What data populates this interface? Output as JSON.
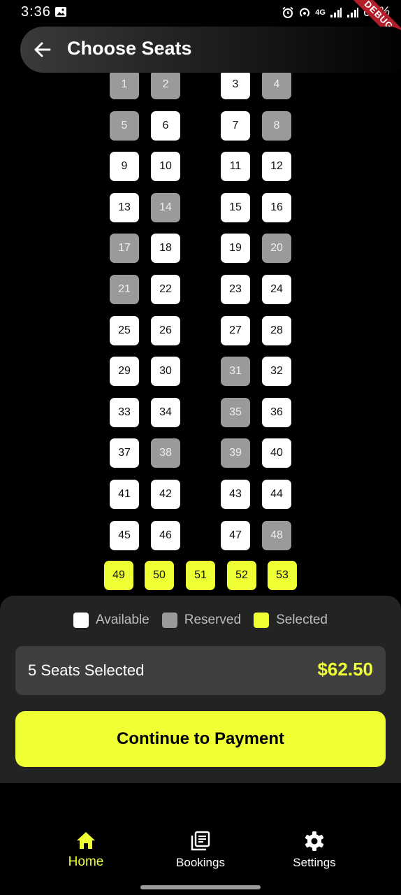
{
  "status_bar": {
    "time": "3:36",
    "battery": "60%",
    "network": "4G",
    "debug_label": "DEBUG"
  },
  "header": {
    "title": "Choose Seats",
    "back_icon": "arrow-left-icon"
  },
  "seats": [
    {
      "n": "1",
      "s": "reserved"
    },
    {
      "n": "2",
      "s": "reserved"
    },
    {
      "n": "3",
      "s": "available"
    },
    {
      "n": "4",
      "s": "reserved"
    },
    {
      "n": "5",
      "s": "reserved"
    },
    {
      "n": "6",
      "s": "available"
    },
    {
      "n": "7",
      "s": "available"
    },
    {
      "n": "8",
      "s": "reserved"
    },
    {
      "n": "9",
      "s": "available"
    },
    {
      "n": "10",
      "s": "available"
    },
    {
      "n": "11",
      "s": "available"
    },
    {
      "n": "12",
      "s": "available"
    },
    {
      "n": "13",
      "s": "available"
    },
    {
      "n": "14",
      "s": "reserved"
    },
    {
      "n": "15",
      "s": "available"
    },
    {
      "n": "16",
      "s": "available"
    },
    {
      "n": "17",
      "s": "reserved"
    },
    {
      "n": "18",
      "s": "available"
    },
    {
      "n": "19",
      "s": "available"
    },
    {
      "n": "20",
      "s": "reserved"
    },
    {
      "n": "21",
      "s": "reserved"
    },
    {
      "n": "22",
      "s": "available"
    },
    {
      "n": "23",
      "s": "available"
    },
    {
      "n": "24",
      "s": "available"
    },
    {
      "n": "25",
      "s": "available"
    },
    {
      "n": "26",
      "s": "available"
    },
    {
      "n": "27",
      "s": "available"
    },
    {
      "n": "28",
      "s": "available"
    },
    {
      "n": "29",
      "s": "available"
    },
    {
      "n": "30",
      "s": "available"
    },
    {
      "n": "31",
      "s": "reserved"
    },
    {
      "n": "32",
      "s": "available"
    },
    {
      "n": "33",
      "s": "available"
    },
    {
      "n": "34",
      "s": "available"
    },
    {
      "n": "35",
      "s": "reserved"
    },
    {
      "n": "36",
      "s": "available"
    },
    {
      "n": "37",
      "s": "available"
    },
    {
      "n": "38",
      "s": "reserved"
    },
    {
      "n": "39",
      "s": "reserved"
    },
    {
      "n": "40",
      "s": "available"
    },
    {
      "n": "41",
      "s": "available"
    },
    {
      "n": "42",
      "s": "available"
    },
    {
      "n": "43",
      "s": "available"
    },
    {
      "n": "44",
      "s": "available"
    },
    {
      "n": "45",
      "s": "available"
    },
    {
      "n": "46",
      "s": "available"
    },
    {
      "n": "47",
      "s": "available"
    },
    {
      "n": "48",
      "s": "reserved"
    }
  ],
  "back_row": [
    {
      "n": "49",
      "s": "selected"
    },
    {
      "n": "50",
      "s": "selected"
    },
    {
      "n": "51",
      "s": "selected"
    },
    {
      "n": "52",
      "s": "selected"
    },
    {
      "n": "53",
      "s": "selected"
    }
  ],
  "legend": {
    "available": "Available",
    "reserved": "Reserved",
    "selected": "Selected"
  },
  "summary": {
    "count_text": "5 Seats Selected",
    "price": "$62.50"
  },
  "continue_label": "Continue to Payment",
  "nav": {
    "home": "Home",
    "bookings": "Bookings",
    "settings": "Settings"
  },
  "colors": {
    "accent": "#eeff33",
    "available": "#ffffff",
    "reserved": "#9a9a9a",
    "panel": "#232323"
  }
}
